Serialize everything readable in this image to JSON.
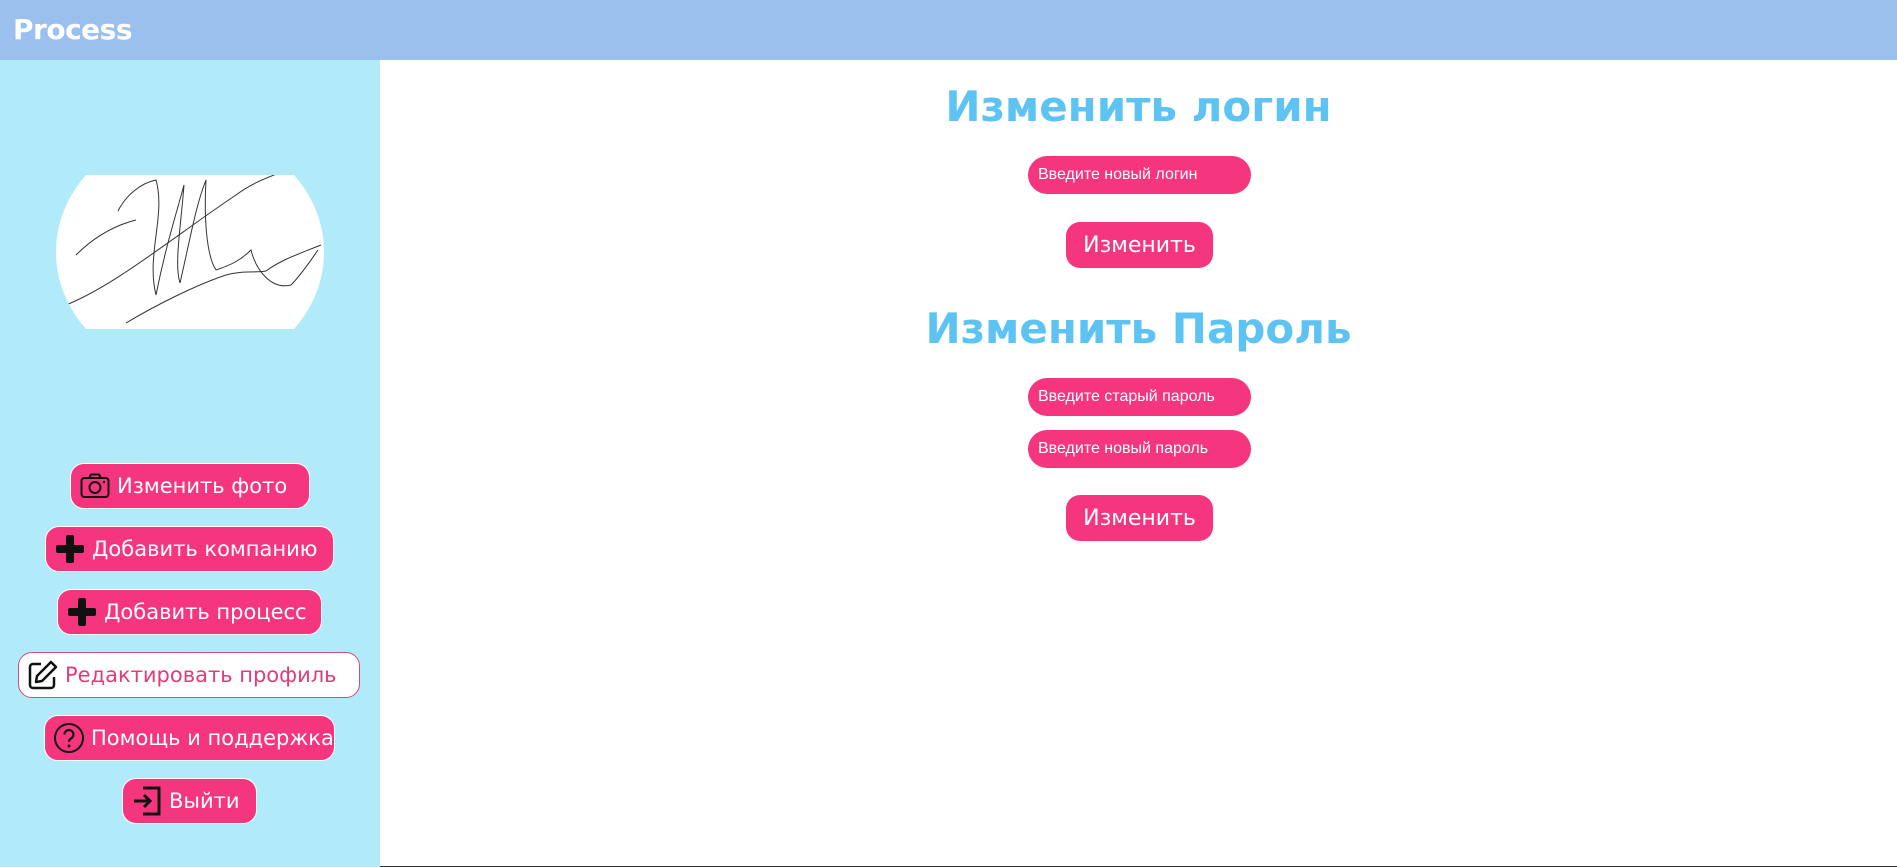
{
  "header": {
    "brand": "Process"
  },
  "sidebar": {
    "avatar_alt": "signature",
    "buttons": [
      {
        "label": "Изменить фото",
        "icon": "camera-icon"
      },
      {
        "label": "Добавить компанию",
        "icon": "plus-icon"
      },
      {
        "label": "Добавить процесс",
        "icon": "plus-icon"
      },
      {
        "label": "Редактировать профиль",
        "icon": "edit-icon",
        "active": true
      },
      {
        "label": "Помощь и поддержка",
        "icon": "help-icon"
      },
      {
        "label": "Выйти",
        "icon": "logout-icon"
      }
    ]
  },
  "login_section": {
    "title": "Изменить логин",
    "new_login_placeholder": "Введите новый логин",
    "submit_label": "Изменить"
  },
  "password_section": {
    "title": "Изменить Пароль",
    "old_password_placeholder": "Введите старый пароль",
    "new_password_placeholder": "Введите новый пароль",
    "submit_label": "Изменить"
  },
  "colors": {
    "header": "#9ac1ee",
    "sidebar": "#b1ebfa",
    "accent": "#f5367e",
    "title": "#5cc3f2"
  }
}
